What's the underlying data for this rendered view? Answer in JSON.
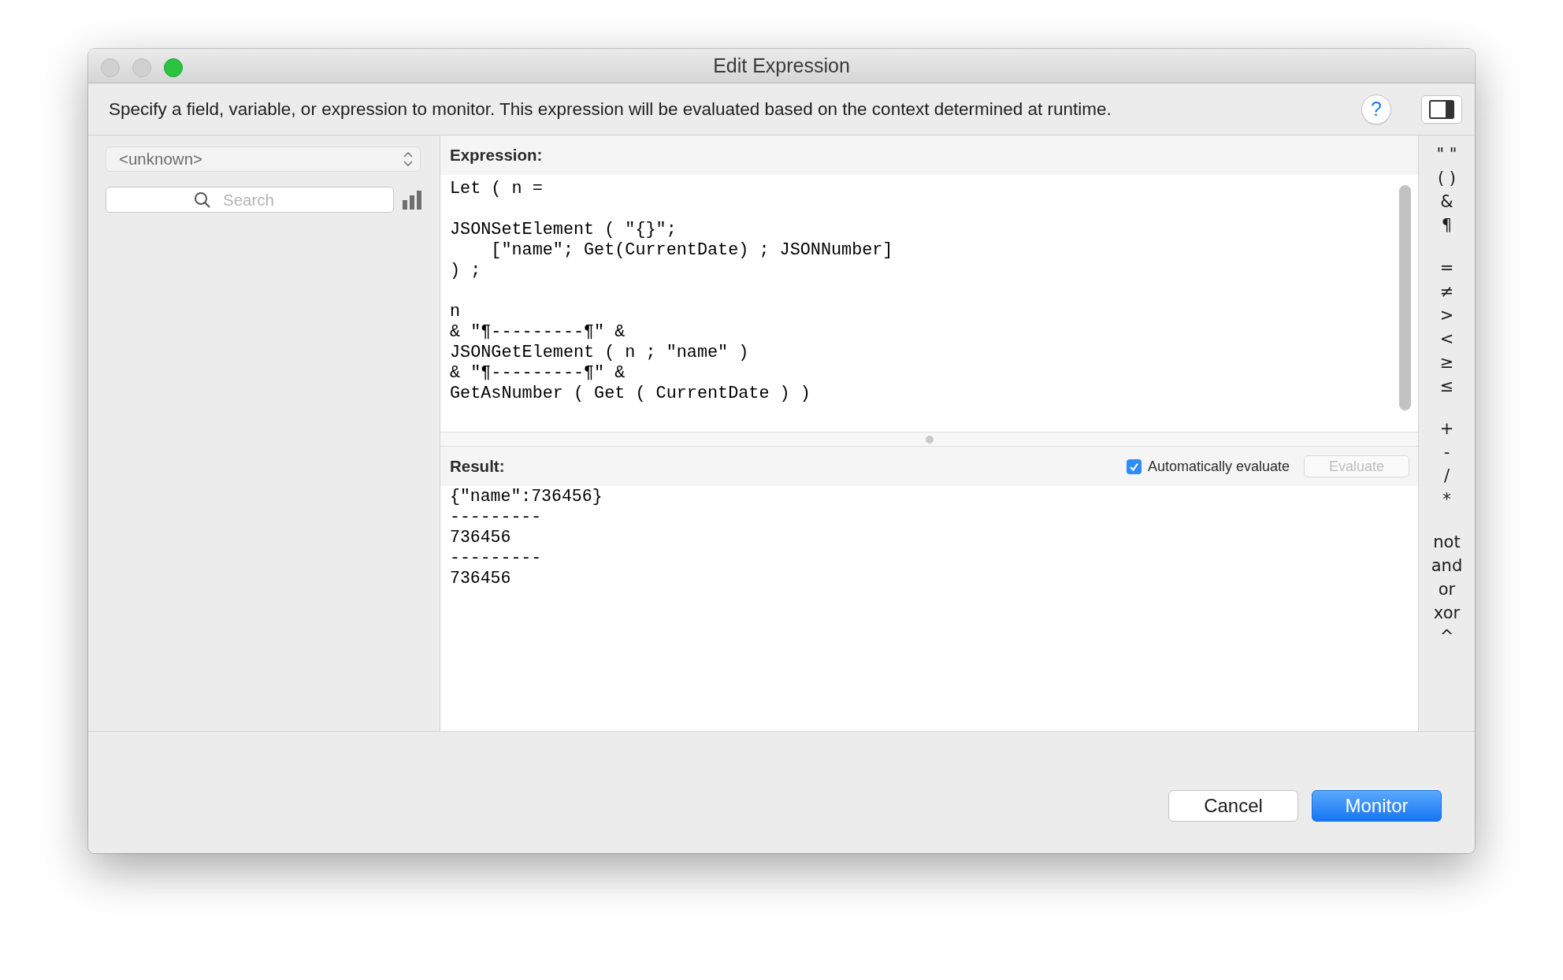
{
  "window": {
    "title": "Edit Expression"
  },
  "instructions": {
    "text": "Specify a field, variable, or expression to monitor. This expression will be evaluated based on the context determined at runtime.",
    "help_button": "?"
  },
  "sidebar": {
    "context_popup": "<unknown>",
    "search": {
      "placeholder": "Search"
    }
  },
  "expression": {
    "label": "Expression:",
    "text": "Let ( n =\n\nJSONSetElement ( \"{}\";\n    [\"name\"; Get(CurrentDate) ; JSONNumber]\n) ;\n\nn\n& \"¶---------¶\" &\nJSONGetElement ( n ; \"name\" )\n& \"¶---------¶\" &\nGetAsNumber ( Get ( CurrentDate ) )"
  },
  "result": {
    "label": "Result:",
    "auto_evaluate": {
      "label": "Automatically evaluate",
      "checked": true
    },
    "evaluate_button": {
      "label": "Evaluate",
      "disabled": true
    },
    "text": "{\"name\":736456}\n---------\n736456\n---------\n736456"
  },
  "operators": [
    [
      "\" \"",
      "( )",
      "&",
      "¶"
    ],
    [
      "=",
      "≠",
      ">",
      "<",
      "≥",
      "≤"
    ],
    [
      "+",
      "-",
      "/",
      "*"
    ],
    [
      "not",
      "and",
      "or",
      "xor",
      "^"
    ]
  ],
  "buttons": [
    {
      "label": "Cancel",
      "kind": "normal"
    },
    {
      "label": "Monitor",
      "kind": "default"
    }
  ]
}
